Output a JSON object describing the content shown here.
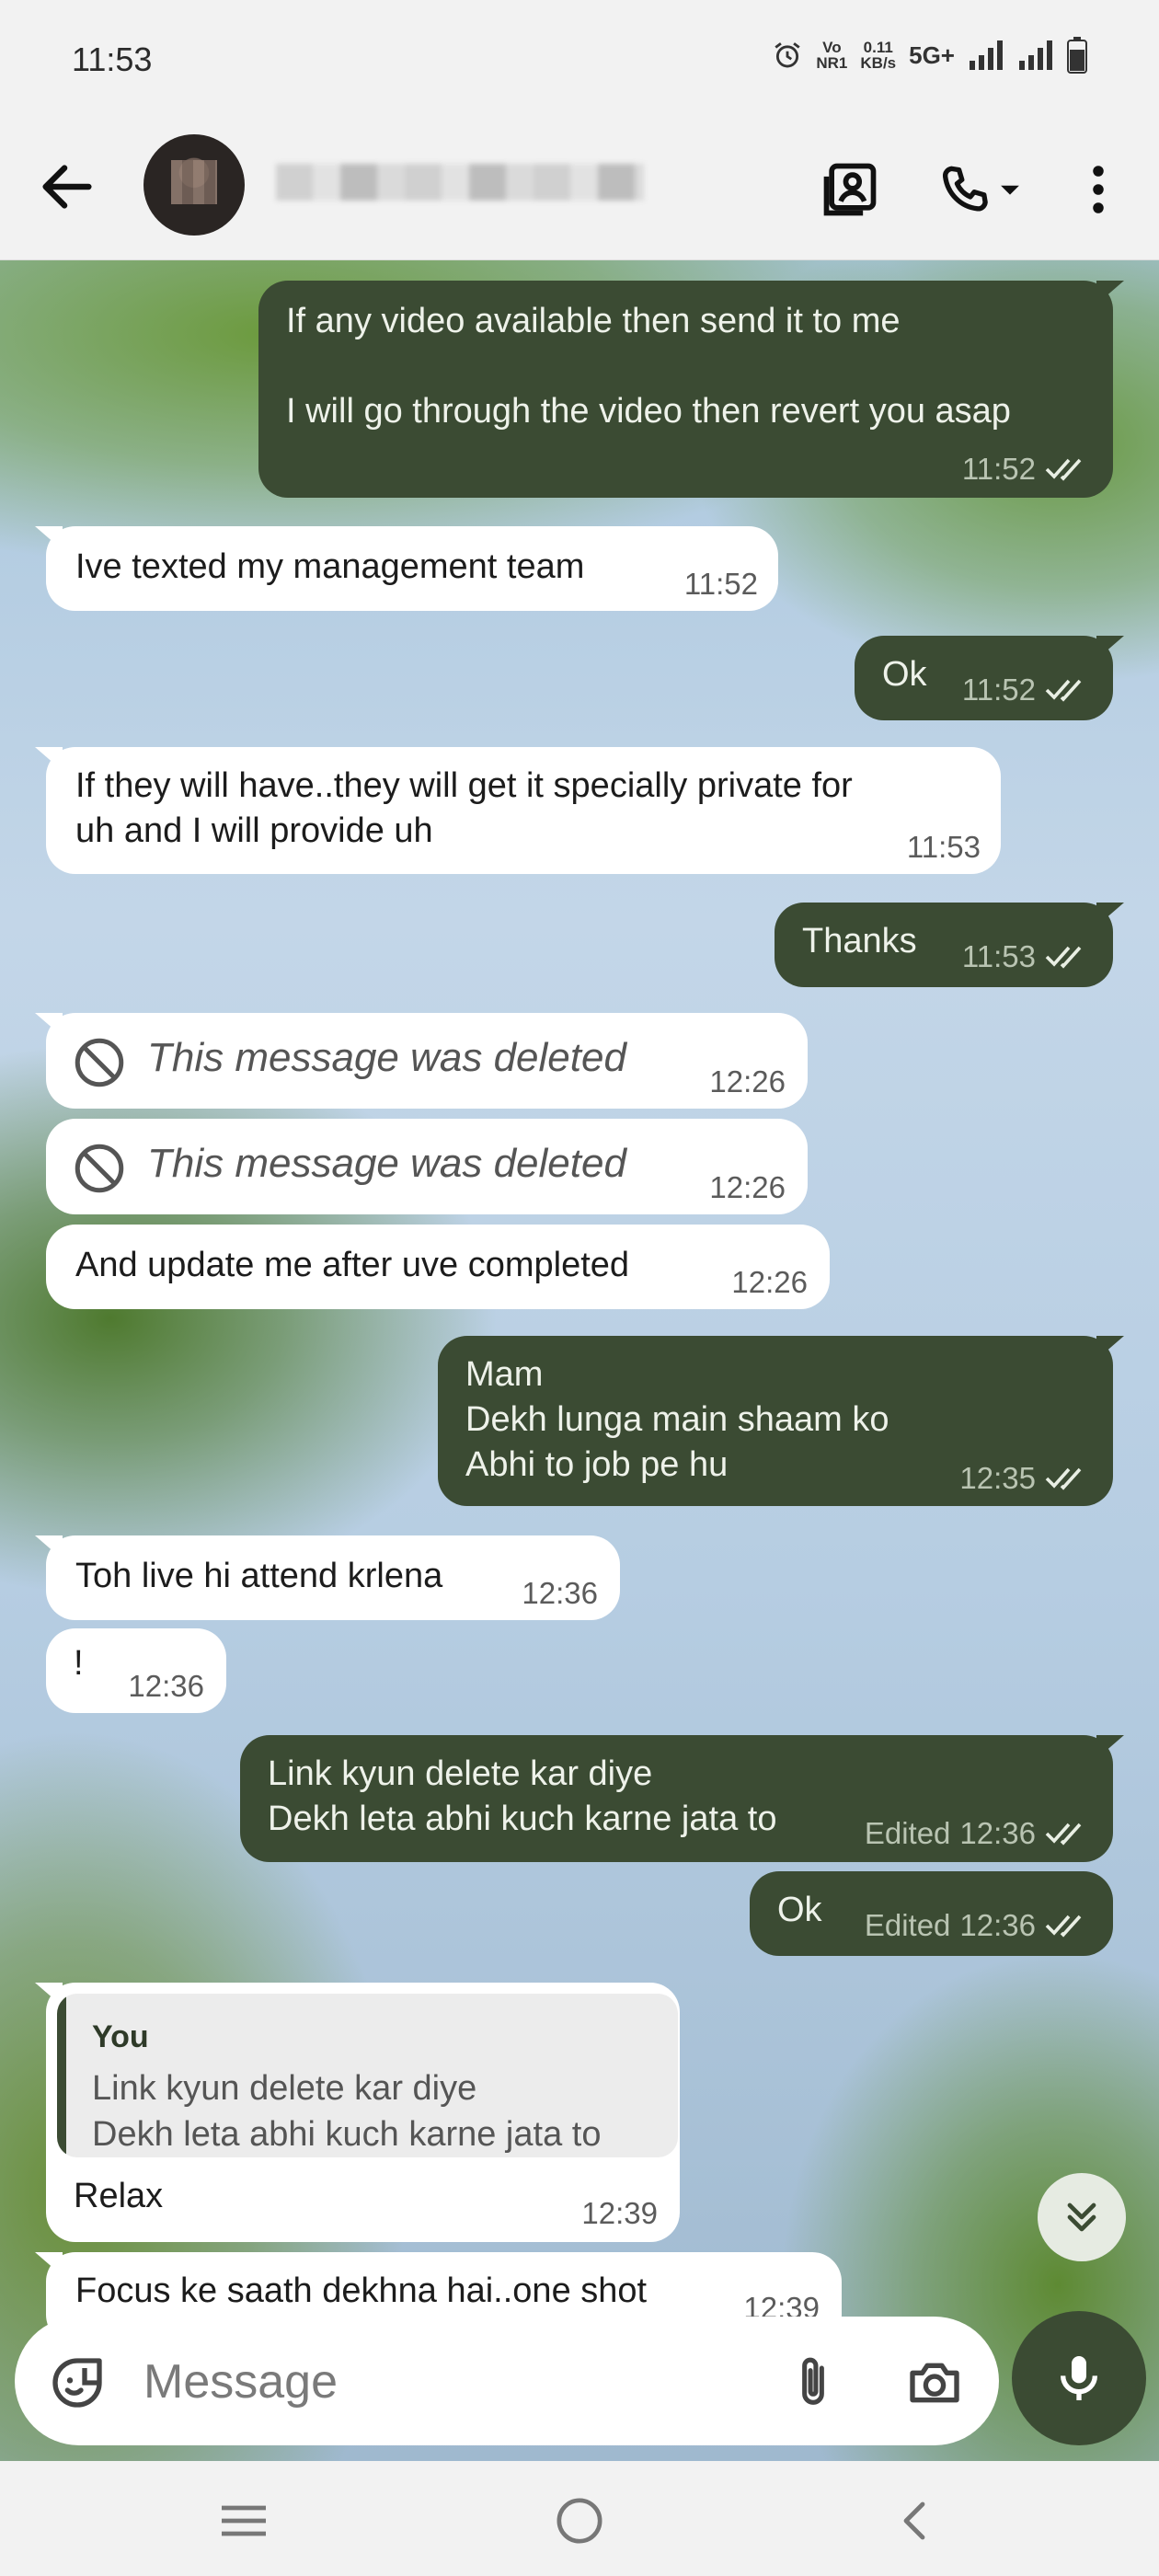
{
  "status_bar": {
    "time": "11:53",
    "volte_top": "Vo",
    "volte_bottom": "NR1",
    "speed_top": "0.11",
    "speed_bottom": "KB/s",
    "network": "5G+"
  },
  "header": {
    "back_icon": "arrow-left-icon",
    "contact_icon": "contact-card-icon",
    "call_icon": "phone-icon",
    "menu_icon": "more-vertical-icon"
  },
  "messages": [
    {
      "dir": "out",
      "text": "If any video available then send it to me\n\nI will go through the video then revert you asap",
      "time": "11:52",
      "edited": "",
      "read": true
    },
    {
      "dir": "in",
      "text": "Ive texted my management team",
      "time": "11:52"
    },
    {
      "dir": "out",
      "text": "Ok",
      "time": "11:52",
      "edited": "",
      "read": true
    },
    {
      "dir": "in",
      "text": "If they will have..they will get it specially private for\nuh and I will provide uh",
      "time": "11:53"
    },
    {
      "dir": "out",
      "text": "Thanks",
      "time": "11:53",
      "edited": "",
      "read": true
    },
    {
      "dir": "in",
      "text": "This message was deleted",
      "time": "12:26",
      "deleted": true
    },
    {
      "dir": "in",
      "text": "This message was deleted",
      "time": "12:26",
      "deleted": true
    },
    {
      "dir": "in",
      "text": "And update me after uve completed",
      "time": "12:26"
    },
    {
      "dir": "out",
      "text": "Mam\nDekh lunga main shaam ko\nAbhi to job pe hu",
      "time": "12:35",
      "edited": "",
      "read": true
    },
    {
      "dir": "in",
      "text": "Toh live hi attend krlena",
      "time": "12:36"
    },
    {
      "dir": "in",
      "text": "!",
      "time": "12:36"
    },
    {
      "dir": "out",
      "text": "Link kyun delete kar diye\nDekh leta abhi kuch karne jata to",
      "time": "12:36",
      "edited": "Edited",
      "read": true
    },
    {
      "dir": "out",
      "text": "Ok",
      "time": "12:36",
      "edited": "Edited",
      "read": true
    },
    {
      "dir": "in",
      "text": "Relax",
      "time": "12:39",
      "quote_author": "You",
      "quote_text": "Link kyun delete kar diye\nDekh leta abhi kuch karne jata to"
    },
    {
      "dir": "in",
      "text": "Focus ke saath dekhna hai..one shot",
      "time": "12:39"
    }
  ],
  "composer": {
    "placeholder": "Message",
    "value": ""
  },
  "colors": {
    "outgoing_bubble": "#3b4b33",
    "incoming_bubble": "#ffffff",
    "accent": "#3b4b33"
  }
}
